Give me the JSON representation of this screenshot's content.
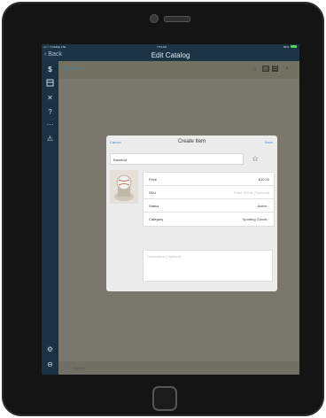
{
  "status_bar": {
    "carrier": "•••○○ T-Mobile  LTE",
    "time": "7:54 AM",
    "battery": "96%"
  },
  "nav": {
    "back_label": "Back",
    "title": "Edit Catalog"
  },
  "sidebar": {
    "icons": [
      "dollar-icon",
      "register-icon",
      "tools-icon",
      "help-icon",
      "more-icon",
      "alert-icon",
      "settings-icon",
      "logout-icon"
    ]
  },
  "catalog": {
    "category_label": "Crossover",
    "search_placeholder": "Search"
  },
  "modal": {
    "cancel_label": "Cancel",
    "title": "Create Item",
    "save_label": "Save",
    "name_value": "Baseball",
    "rows": [
      {
        "label": "Price",
        "value": "$10.00",
        "placeholder": false
      },
      {
        "label": "SKU",
        "value": "Enter SKU# (Optional)",
        "placeholder": true
      },
      {
        "label": "Status",
        "value": "Active",
        "placeholder": false
      },
      {
        "label": "Category",
        "value": "Sporting Goods",
        "placeholder": false
      }
    ],
    "description_placeholder": "Description (Optional)"
  }
}
